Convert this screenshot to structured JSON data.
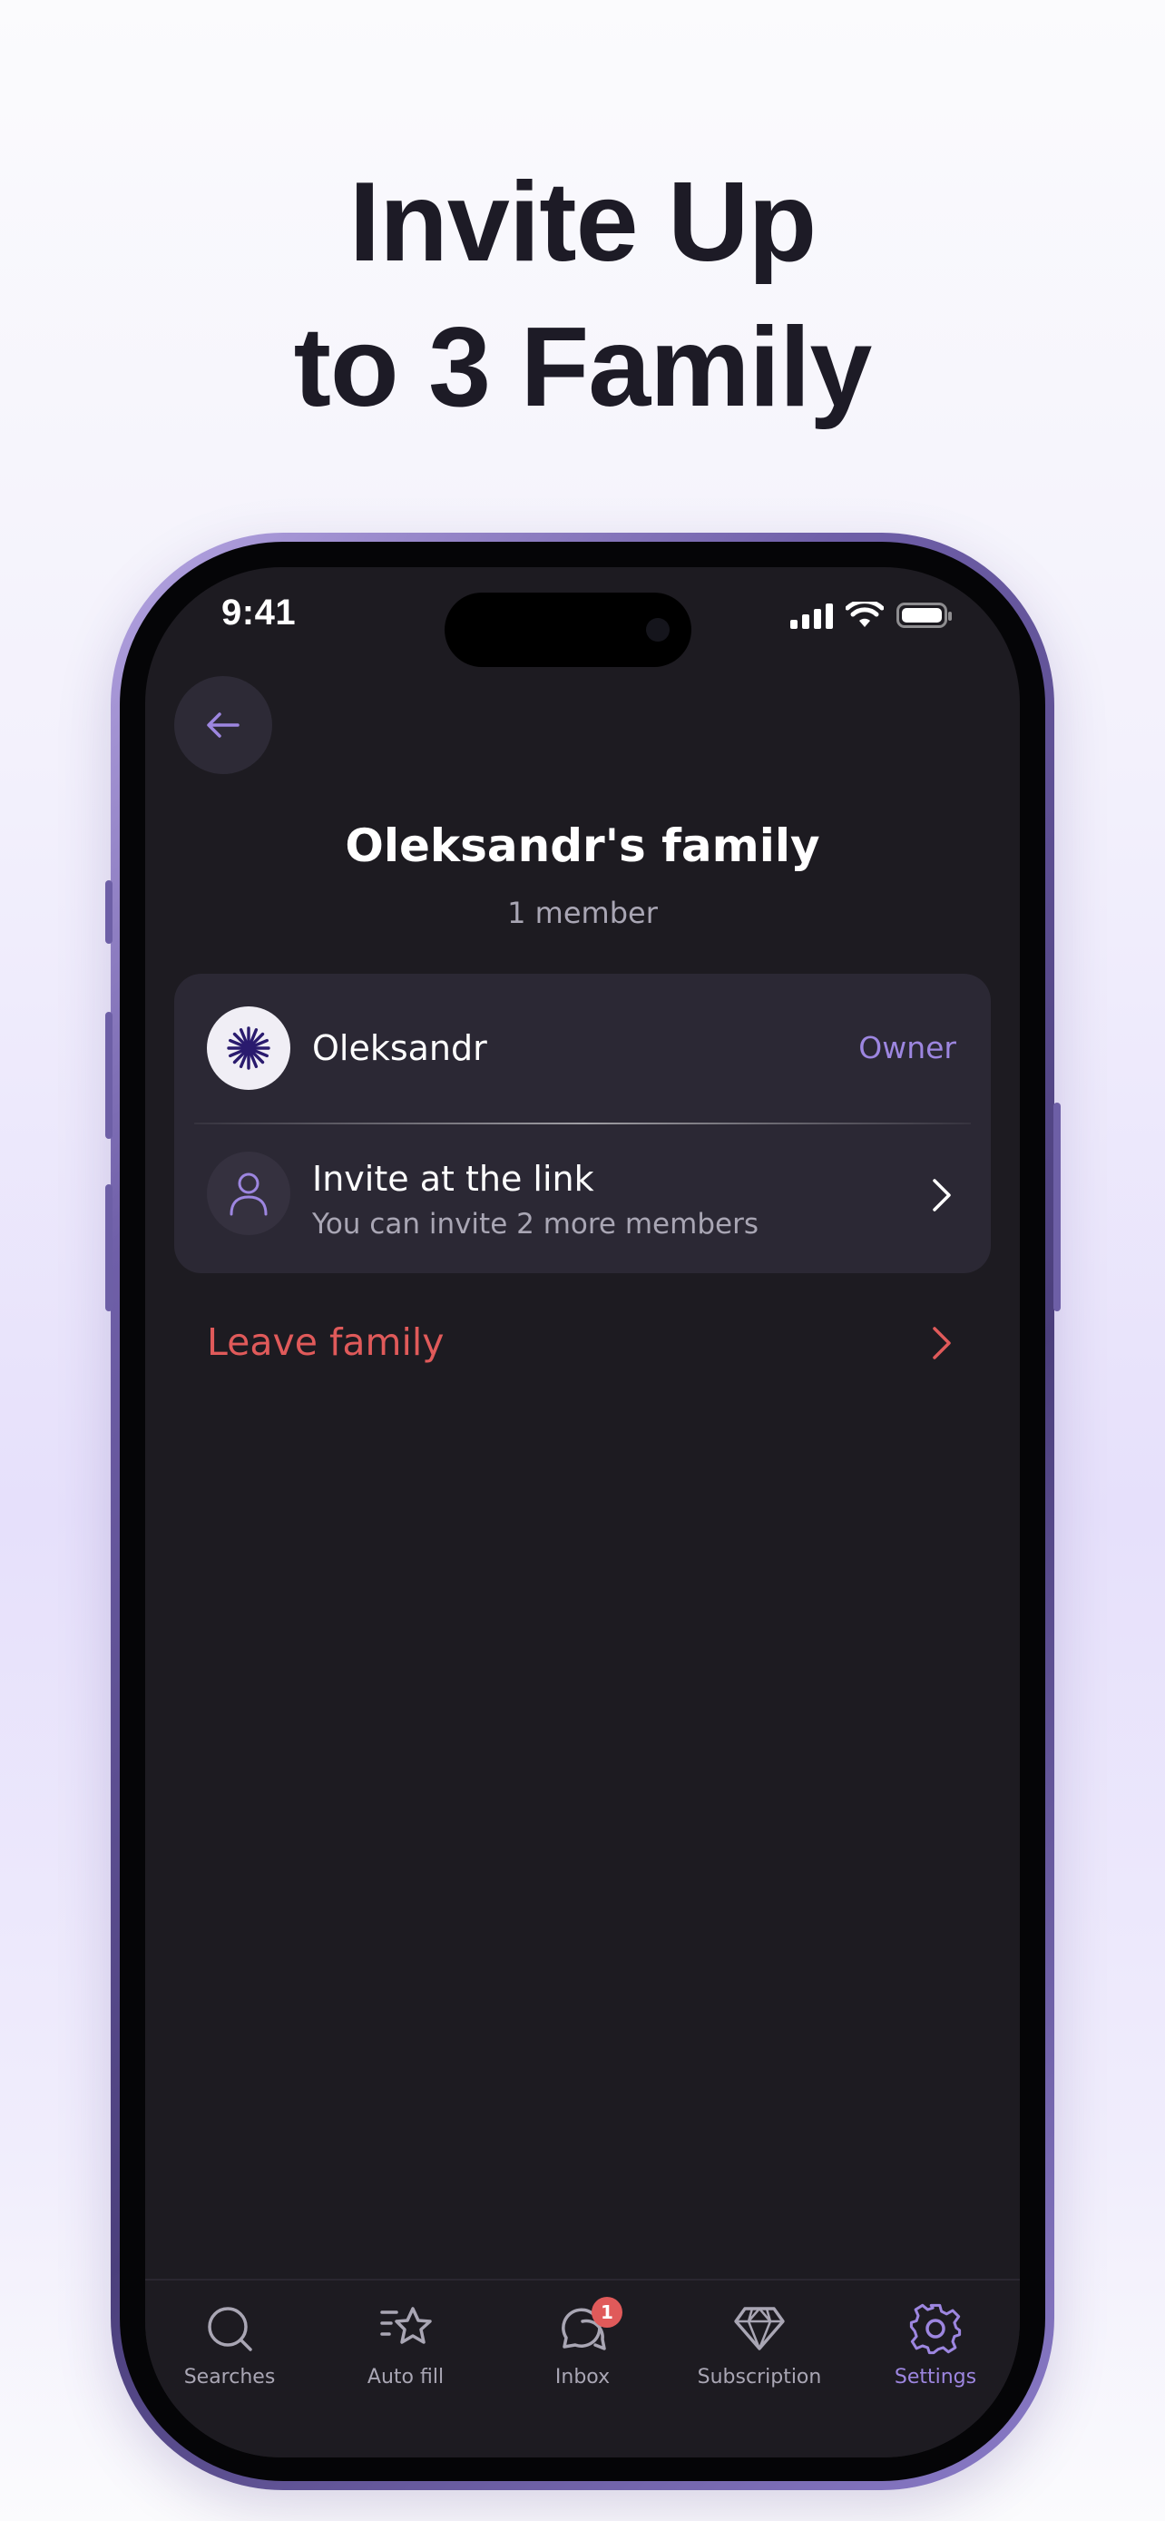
{
  "headline": {
    "line1": "Invite Up",
    "line2": "to 3 Family"
  },
  "status_bar": {
    "time": "9:41"
  },
  "header": {
    "back_icon": "arrow-left-icon",
    "title": "Oleksandr's family",
    "subtitle": "1 member"
  },
  "members": [
    {
      "name": "Oleksandr",
      "role": "Owner",
      "avatar_icon": "sunburst-icon"
    }
  ],
  "invite": {
    "title": "Invite at the link",
    "subtitle": "You can invite 2 more members",
    "icon": "user-icon"
  },
  "leave": {
    "label": "Leave family"
  },
  "tabbar": {
    "items": [
      {
        "label": "Searches",
        "icon": "search-icon"
      },
      {
        "label": "Auto fill",
        "icon": "star-icon"
      },
      {
        "label": "Inbox",
        "icon": "chat-icon",
        "badge": "1"
      },
      {
        "label": "Subscription",
        "icon": "diamond-icon"
      },
      {
        "label": "Settings",
        "icon": "gear-icon"
      }
    ],
    "active": "Settings"
  },
  "colors": {
    "accent": "#9d86e0",
    "danger": "#e05a5a",
    "background": "#1d1b21",
    "card": "#2b2834"
  }
}
